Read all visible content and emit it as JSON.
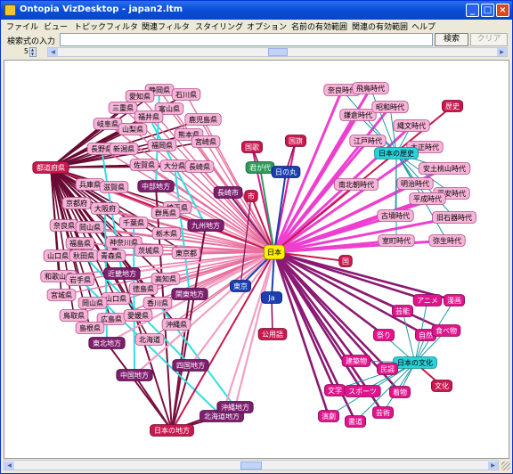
{
  "window": {
    "title": "Ontopia VizDesktop - japan2.ltm"
  },
  "menu": [
    "ファイル",
    "ビュー",
    "トピックフィルタ",
    "関連フィルタ",
    "スタイリング",
    "オプション",
    "名前の有効範囲",
    "関連の有効範囲",
    "ヘルプ"
  ],
  "search": {
    "label": "検索式の入力",
    "value": "",
    "search_button": "検索",
    "clear_button": "クリア"
  },
  "depth": {
    "value": "5"
  },
  "colors": {
    "window_border": "#0831d9",
    "titlebar": "#0a4fd8",
    "close_button": "#d9461c",
    "pink_node": "#f7b4d8",
    "magenta_node": "#e0148c",
    "purple_node": "#7d1f6e",
    "red_node": "#c8194f",
    "cyan_node": "#29d1d8",
    "green_node": "#2f9a5a",
    "blue_node": "#1a3fb0",
    "yellow_node": "#fff200"
  },
  "graph": {
    "nodes": [
      {
        "id": "nihon",
        "label": "日本",
        "style": "yellow"
      },
      {
        "id": "todofuken",
        "label": "都道府県",
        "style": "red"
      },
      {
        "id": "shizuoka",
        "label": "静岡県",
        "style": "pink"
      },
      {
        "id": "aichi",
        "label": "愛知県",
        "style": "pink"
      },
      {
        "id": "ishikawa",
        "label": "石川県",
        "style": "pink"
      },
      {
        "id": "mie",
        "label": "三重県",
        "style": "pink"
      },
      {
        "id": "toyama",
        "label": "富山県",
        "style": "pink"
      },
      {
        "id": "fukui",
        "label": "福井県",
        "style": "pink"
      },
      {
        "id": "kagoshima",
        "label": "鹿児島県",
        "style": "pink"
      },
      {
        "id": "gifu",
        "label": "岐阜県",
        "style": "pink"
      },
      {
        "id": "yamanashi",
        "label": "山梨県",
        "style": "pink"
      },
      {
        "id": "kumamoto",
        "label": "熊本県",
        "style": "pink"
      },
      {
        "id": "nagano",
        "label": "長野県",
        "style": "pink"
      },
      {
        "id": "niigata",
        "label": "新潟県",
        "style": "pink"
      },
      {
        "id": "fukuoka",
        "label": "福岡県",
        "style": "pink"
      },
      {
        "id": "miyazaki",
        "label": "宮崎県",
        "style": "pink"
      },
      {
        "id": "saga",
        "label": "佐賀県",
        "style": "pink"
      },
      {
        "id": "oita",
        "label": "大分県",
        "style": "pink"
      },
      {
        "id": "nagasaki",
        "label": "長崎県",
        "style": "pink"
      },
      {
        "id": "hyogo",
        "label": "兵庫県",
        "style": "pink"
      },
      {
        "id": "shiga",
        "label": "滋賀県",
        "style": "pink"
      },
      {
        "id": "chubu",
        "label": "中部地方",
        "style": "purple"
      },
      {
        "id": "nagoya",
        "label": "長崎市",
        "style": "purple"
      },
      {
        "id": "kyoto",
        "label": "京都府",
        "style": "pink"
      },
      {
        "id": "osaka",
        "label": "大阪府",
        "style": "pink"
      },
      {
        "id": "saitama",
        "label": "埼玉県",
        "style": "pink"
      },
      {
        "id": "gunma",
        "label": "群馬県",
        "style": "pink"
      },
      {
        "id": "nara",
        "label": "奈良県",
        "style": "pink"
      },
      {
        "id": "okayama_t",
        "label": "岡山県",
        "style": "pink"
      },
      {
        "id": "chiba",
        "label": "千葉県",
        "style": "pink"
      },
      {
        "id": "tochigi",
        "label": "栃木県",
        "style": "pink"
      },
      {
        "id": "kyushu",
        "label": "九州地方",
        "style": "purple"
      },
      {
        "id": "fukushima",
        "label": "福島県",
        "style": "pink"
      },
      {
        "id": "kanagawa",
        "label": "神奈川県",
        "style": "pink"
      },
      {
        "id": "yamaguchi_c",
        "label": "山口県",
        "style": "pink"
      },
      {
        "id": "akita",
        "label": "秋田県",
        "style": "pink"
      },
      {
        "id": "ibaraki",
        "label": "茨城県",
        "style": "pink"
      },
      {
        "id": "tokyo_to",
        "label": "東京都",
        "style": "pink"
      },
      {
        "id": "aomori",
        "label": "青森県",
        "style": "pink"
      },
      {
        "id": "wakayama",
        "label": "和歌山県",
        "style": "pink"
      },
      {
        "id": "kinki",
        "label": "近畿地方",
        "style": "purple"
      },
      {
        "id": "iwate",
        "label": "岩手県",
        "style": "pink"
      },
      {
        "id": "tokushima",
        "label": "徳島県",
        "style": "pink"
      },
      {
        "id": "kochi",
        "label": "高知県",
        "style": "pink"
      },
      {
        "id": "miyagi",
        "label": "宮城県",
        "style": "pink"
      },
      {
        "id": "yamaguchi",
        "label": "山口県",
        "style": "pink"
      },
      {
        "id": "kagawa",
        "label": "香川県",
        "style": "pink"
      },
      {
        "id": "kanto",
        "label": "関東地方",
        "style": "purple"
      },
      {
        "id": "tottori",
        "label": "鳥取県",
        "style": "pink"
      },
      {
        "id": "okayama",
        "label": "岡山県",
        "style": "pink"
      },
      {
        "id": "hiroshima",
        "label": "広島県",
        "style": "pink"
      },
      {
        "id": "okinawa_k",
        "label": "沖縄県",
        "style": "pink"
      },
      {
        "id": "shimane",
        "label": "島根県",
        "style": "pink"
      },
      {
        "id": "ehime",
        "label": "愛媛県",
        "style": "pink"
      },
      {
        "id": "tohoku",
        "label": "東北地方",
        "style": "purple"
      },
      {
        "id": "hokkaido",
        "label": "北海道",
        "style": "pink"
      },
      {
        "id": "chugoku",
        "label": "中国地方",
        "style": "purple"
      },
      {
        "id": "shikoku",
        "label": "四国地方",
        "style": "purple"
      },
      {
        "id": "hokkaido_c",
        "label": "北海道地方",
        "style": "purple"
      },
      {
        "id": "okinawa_c",
        "label": "沖縄地方",
        "style": "purple"
      },
      {
        "id": "nihonnochiho",
        "label": "日本の地方",
        "style": "red"
      },
      {
        "id": "shi",
        "label": "市",
        "style": "red"
      },
      {
        "id": "tokyo",
        "label": "東京",
        "style": "blue"
      },
      {
        "id": "kokka",
        "label": "国歌",
        "style": "red"
      },
      {
        "id": "kimigayo",
        "label": "君が代",
        "style": "green"
      },
      {
        "id": "kokki",
        "label": "国旗",
        "style": "red"
      },
      {
        "id": "hinomaru",
        "label": "日の丸",
        "style": "blue"
      },
      {
        "id": "kuni",
        "label": "国",
        "style": "red"
      },
      {
        "id": "ja",
        "label": "Ja",
        "style": "blue"
      },
      {
        "id": "koyogo",
        "label": "公用語",
        "style": "red"
      },
      {
        "id": "nara_jidai",
        "label": "奈良時代",
        "style": "pink"
      },
      {
        "id": "asuka",
        "label": "飛鳥時代",
        "style": "pink"
      },
      {
        "id": "kamakura",
        "label": "鎌倉時代",
        "style": "pink"
      },
      {
        "id": "showa",
        "label": "昭和時代",
        "style": "pink"
      },
      {
        "id": "rekishi",
        "label": "歴史",
        "style": "red"
      },
      {
        "id": "jomon",
        "label": "縄文時代",
        "style": "pink"
      },
      {
        "id": "edo",
        "label": "江戸時代",
        "style": "pink"
      },
      {
        "id": "taisho",
        "label": "大正時代",
        "style": "pink"
      },
      {
        "id": "nihonnorekishi",
        "label": "日本の歴史",
        "style": "cyan"
      },
      {
        "id": "azuchi",
        "label": "安土桃山時代",
        "style": "pink"
      },
      {
        "id": "nanboku",
        "label": "南北朝時代",
        "style": "pink"
      },
      {
        "id": "meiji",
        "label": "明治時代",
        "style": "pink"
      },
      {
        "id": "heian",
        "label": "平安時代",
        "style": "pink"
      },
      {
        "id": "heisei",
        "label": "平成時代",
        "style": "pink"
      },
      {
        "id": "kofun",
        "label": "古墳時代",
        "style": "pink"
      },
      {
        "id": "kyusekki",
        "label": "旧石器時代",
        "style": "pink"
      },
      {
        "id": "muromachi",
        "label": "室町時代",
        "style": "pink"
      },
      {
        "id": "yayoi",
        "label": "弥生時代",
        "style": "pink"
      },
      {
        "id": "anime",
        "label": "アニメ",
        "style": "magenta"
      },
      {
        "id": "manga",
        "label": "漫画",
        "style": "magenta"
      },
      {
        "id": "geino",
        "label": "芸能",
        "style": "magenta"
      },
      {
        "id": "shizen",
        "label": "自然",
        "style": "magenta"
      },
      {
        "id": "tabemono",
        "label": "食べ物",
        "style": "magenta"
      },
      {
        "id": "matsuri",
        "label": "祭り",
        "style": "magenta"
      },
      {
        "id": "nihonnobunka",
        "label": "日本の文化",
        "style": "cyan"
      },
      {
        "id": "kenchiku",
        "label": "建築物",
        "style": "magenta"
      },
      {
        "id": "minyo",
        "label": "民謡",
        "style": "magenta"
      },
      {
        "id": "bunka",
        "label": "文化",
        "style": "red"
      },
      {
        "id": "bungaku",
        "label": "文学",
        "style": "magenta"
      },
      {
        "id": "sports",
        "label": "スポーツ",
        "style": "magenta"
      },
      {
        "id": "kimono",
        "label": "着物",
        "style": "magenta"
      },
      {
        "id": "engeki",
        "label": "演劇",
        "style": "magenta"
      },
      {
        "id": "shodo",
        "label": "書道",
        "style": "magenta"
      },
      {
        "id": "geijutsu",
        "label": "芸術",
        "style": "magenta"
      }
    ]
  }
}
